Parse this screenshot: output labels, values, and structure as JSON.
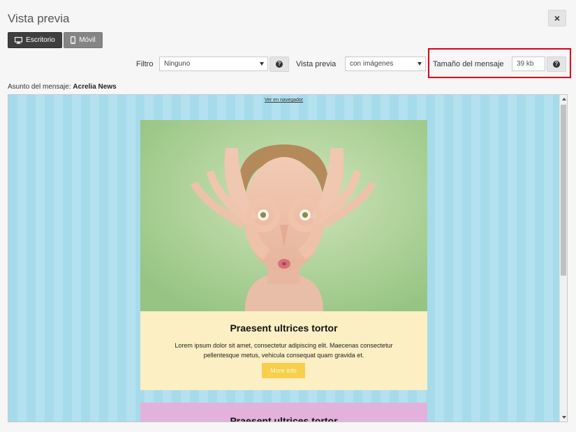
{
  "modal": {
    "title": "Vista previa",
    "close_label": "×"
  },
  "view_modes": [
    {
      "label": "Escritorio",
      "icon": "monitor-icon",
      "active": true
    },
    {
      "label": "Móvil",
      "icon": "mobile-icon",
      "active": false
    }
  ],
  "toolbar": {
    "filter_label": "Filtro",
    "filter_value": "Ninguno",
    "preview_label": "Vista previa",
    "preview_value": "con imágenes",
    "size_label": "Tamaño del mensaje",
    "size_value": "39 kb",
    "help_glyph": "?"
  },
  "subject": {
    "label": "Asunto del mensaje:",
    "value": "Acrelia News"
  },
  "email": {
    "view_in_browser": "Ver en navegador",
    "blocks": [
      {
        "title": "Praesent ultrices tortor",
        "body": "Lorem ipsum dolor sit amet, consectetur adipiscing elit. Maecenas consectetur pellentesque metus, vehicula consequat quam gravida et.",
        "button": "More info",
        "background": "#fdefc4"
      },
      {
        "title": "Praesent ultrices tortor",
        "background": "#e3b2dc"
      }
    ]
  },
  "colors": {
    "preview_background": "#a6dbeb",
    "highlight_border": "#d9001b",
    "button_accent": "#f7cf4a"
  }
}
